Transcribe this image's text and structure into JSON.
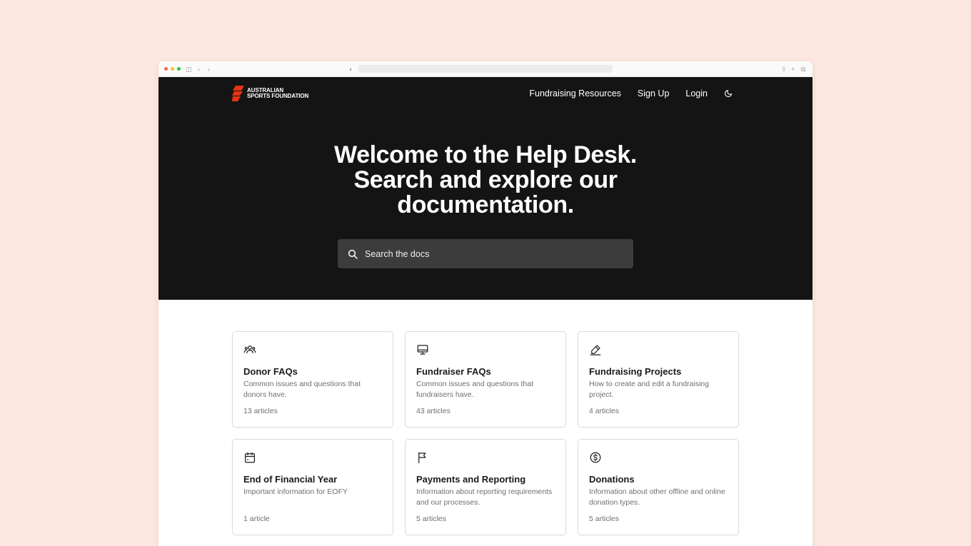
{
  "brand": {
    "logo_line1": "AUSTRALIAN",
    "logo_line2": "SPORTS FOUNDATION",
    "accent": "#e63312"
  },
  "nav": {
    "links": [
      "Fundraising Resources",
      "Sign Up",
      "Login"
    ],
    "theme_toggle_icon": "moon-icon"
  },
  "hero": {
    "title_lines": [
      "Welcome to the Help Desk.",
      "Search and explore our",
      "documentation."
    ],
    "search_placeholder": "Search the docs"
  },
  "cards": [
    {
      "icon": "users-icon",
      "title": "Donor FAQs",
      "description": "Common issues and questions that donors have.",
      "count": "13 articles"
    },
    {
      "icon": "monitor-icon",
      "title": "Fundraiser FAQs",
      "description": "Common issues and questions that fundraisers have.",
      "count": "43 articles"
    },
    {
      "icon": "pencil-icon",
      "title": "Fundraising Projects",
      "description": "How to create and edit a fundraising project.",
      "count": "4 articles"
    },
    {
      "icon": "calendar-icon",
      "title": "End of Financial Year",
      "description": "Important information for EOFY",
      "count": "1 article"
    },
    {
      "icon": "flag-icon",
      "title": "Payments and Reporting",
      "description": "Information about reporting requirements and our processes.",
      "count": "5 articles"
    },
    {
      "icon": "dollar-icon",
      "title": "Donations",
      "description": "Information about other offline and online donation types.",
      "count": "5 articles"
    }
  ],
  "colors": {
    "page_background": "#fde7e1",
    "header_background": "#141414",
    "search_background": "#3c3c3c"
  }
}
